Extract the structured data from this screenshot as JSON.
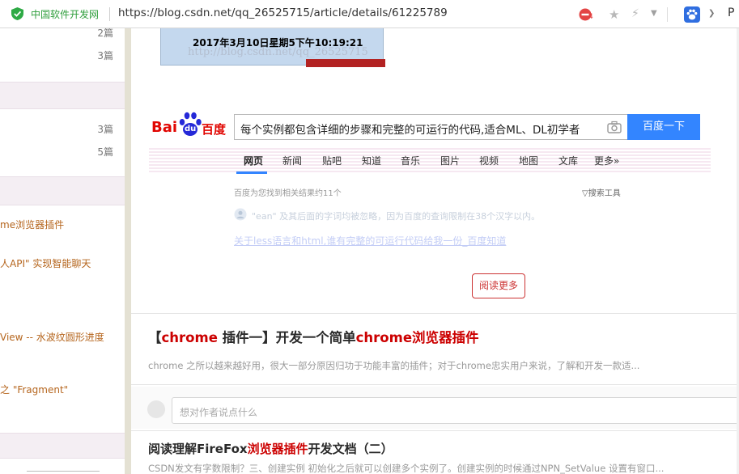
{
  "addressbar": {
    "site_name": "中国软件开发网",
    "url": "https://blog.csdn.net/qq_26525715/article/details/61225789",
    "blocked_count": "4",
    "extra_glyph": "P"
  },
  "sidebar": {
    "counts": [
      {
        "label": "2篇"
      },
      {
        "label": "3篇"
      },
      {
        "label": "3篇"
      },
      {
        "label": "5篇"
      }
    ],
    "links": [
      {
        "label": "me浏览器插件"
      },
      {
        "label": "人API\" 实现智能聊天"
      },
      {
        "label": "View -- 水波纹圆形进度"
      },
      {
        "label": "之 \"Fragment\""
      }
    ]
  },
  "screenshot_caption": "2017年3月10日星期5下午10:19:21",
  "watermark": "http://blog.csdn.net/qq_26525715",
  "baidu": {
    "logo_bai": "Bai",
    "logo_du": "du",
    "logo_cn": "百度",
    "query": "每个实例都包含详细的步骤和完整的可运行的代码,适合ML、DL初学者",
    "search_button": "百度一下",
    "tabs": [
      {
        "label": "网页"
      },
      {
        "label": "新闻"
      },
      {
        "label": "贴吧"
      },
      {
        "label": "知道"
      },
      {
        "label": "音乐"
      },
      {
        "label": "图片"
      },
      {
        "label": "视频"
      },
      {
        "label": "地图"
      },
      {
        "label": "文库"
      },
      {
        "label": "更多»"
      }
    ],
    "result_count": "百度为您找到相关结果约11个",
    "tools": "▽搜索工具",
    "notice": "\"ean\" 及其后面的字词均被忽略，因为百度的查询限制在38个汉字以内。",
    "result_link": "关于less语言和html,谁有完整的可运行代码给我一份_百度知道"
  },
  "read_more": "阅读更多",
  "article": {
    "title_prefix": "【",
    "title_kw1": "chrome",
    "title_mid": " 插件一】开发一个简单",
    "title_kw2": "chrome浏览器插件",
    "summary": "chrome 之所以越来越好用，很大一部分原因归功于功能丰富的插件；对于chrome忠实用户来说，了解和开发一款适..."
  },
  "comment": {
    "placeholder": "想对作者说点什么"
  },
  "article2": {
    "title_pre": "阅读理解FireFox",
    "title_kw": "浏览器插件",
    "title_post": "开发文档（二）",
    "summary": "CSDN发文有字数限制？三、创建实例 初始化之后就可以创建多个实例了。创建实例的时候通过NPN_SetValue 设置有窗口..."
  }
}
